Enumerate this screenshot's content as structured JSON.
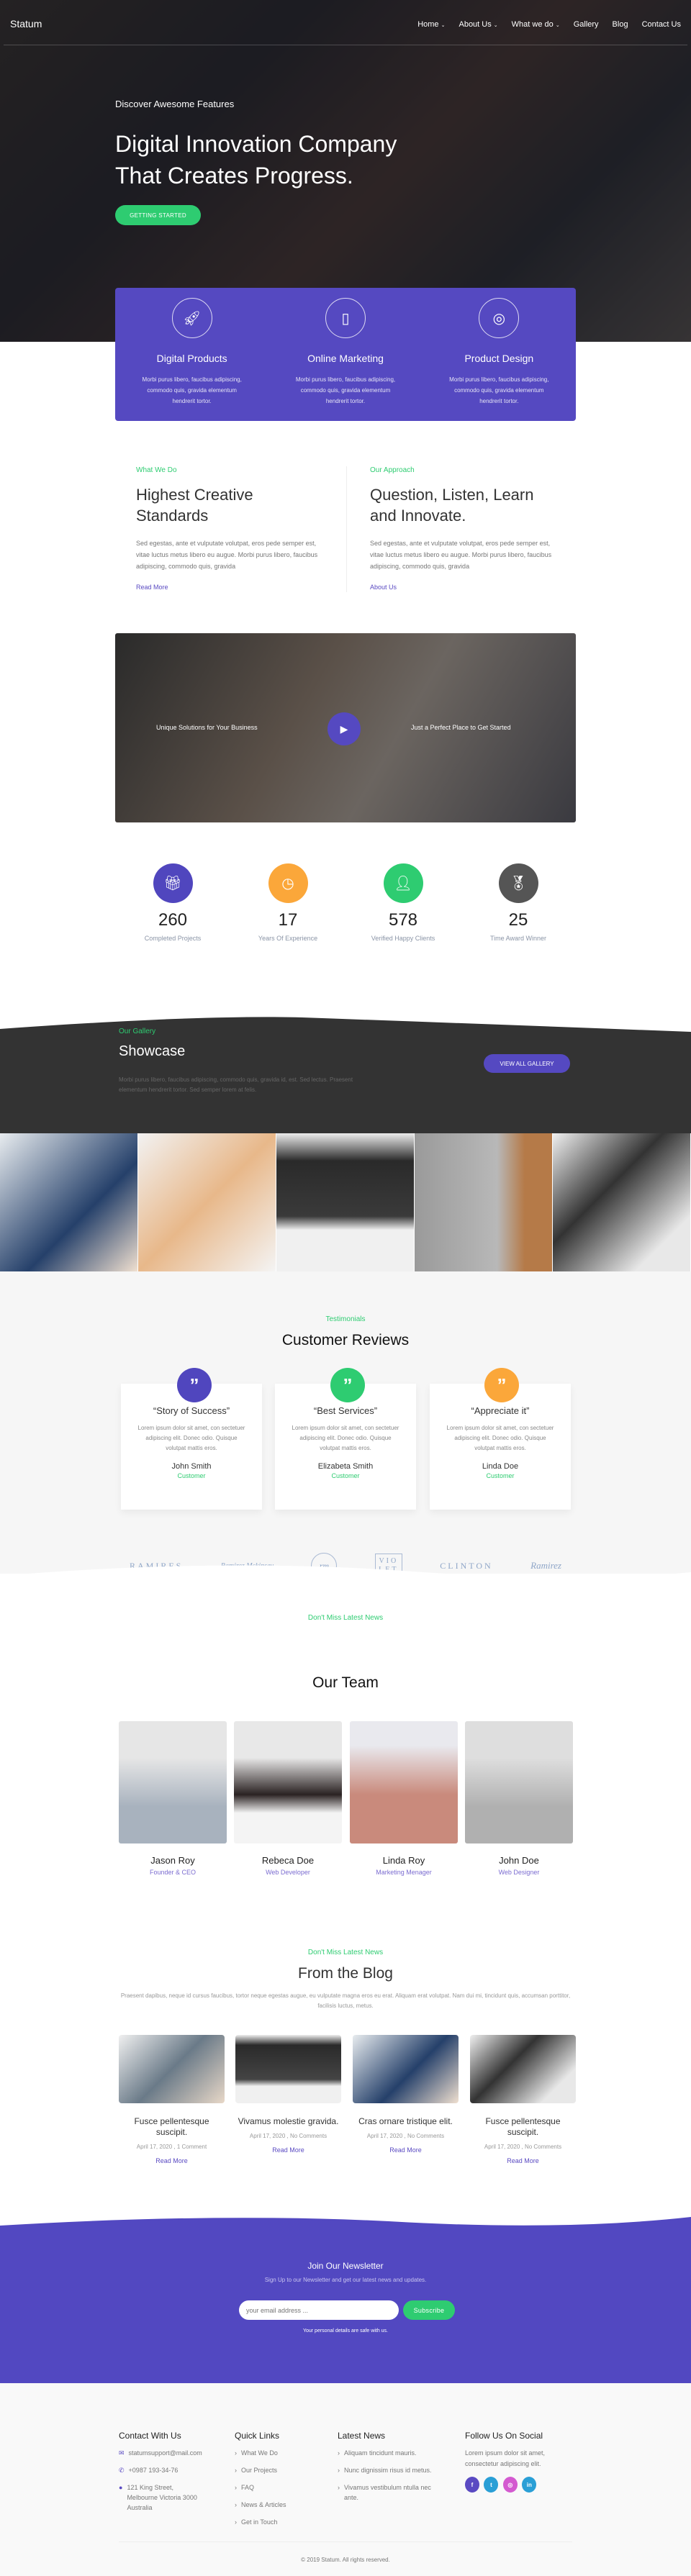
{
  "nav": {
    "brand": "Statum",
    "items": [
      {
        "label": "Home",
        "dropdown": true
      },
      {
        "label": "About Us",
        "dropdown": true
      },
      {
        "label": "What we do",
        "dropdown": true
      },
      {
        "label": "Gallery"
      },
      {
        "label": "Blog"
      },
      {
        "label": "Contact Us"
      }
    ]
  },
  "hero": {
    "tagline": "Discover Awesome Features",
    "title_line1": "Digital Innovation Company",
    "title_line2": "That Creates Progress.",
    "cta": "GETTING STARTED"
  },
  "features": [
    {
      "icon": "rocket-icon",
      "title": "Digital Products",
      "text": "Morbi purus libero, faucibus adipiscing, commodo quis, gravida elementum hendrerit tortor."
    },
    {
      "icon": "mobile-icon",
      "title": "Online Marketing",
      "text": "Morbi purus libero, faucibus adipiscing, commodo quis, gravida elementum hendrerit tortor."
    },
    {
      "icon": "fingerprint-icon",
      "title": "Product Design",
      "text": "Morbi purus libero, faucibus adipiscing, commodo quis, gravida elementum hendrerit tortor."
    }
  ],
  "about": [
    {
      "label": "What We Do",
      "title": "Highest Creative Standards",
      "text": "Sed egestas, ante et vulputate volutpat, eros pede semper est, vitae luctus metus libero eu augue. Morbi purus libero, faucibus adipiscing, commodo quis, gravida",
      "link": "Read More"
    },
    {
      "label": "Our Approach",
      "title": "Question, Listen, Learn and Innovate.",
      "text": "Sed egestas, ante et vulputate volutpat, eros pede semper est, vitae luctus metus libero eu augue. Morbi purus libero, faucibus adipiscing, commodo quis, gravida",
      "link": "About Us"
    }
  ],
  "video": {
    "left_text": "Unique Solutions for Your Business",
    "right_text": "Just a Perfect Place to Get Started",
    "icon": "play-icon"
  },
  "stats": [
    {
      "value": "260",
      "label": "Completed Projects",
      "color": "#5046be",
      "icon": "gift-icon"
    },
    {
      "value": "17",
      "label": "Years Of Experience",
      "color": "#fba73a",
      "icon": "clock-icon"
    },
    {
      "value": "578",
      "label": "Verified Happy Clients",
      "color": "#2ecc71",
      "icon": "user-icon"
    },
    {
      "value": "25",
      "label": "Time Award Winner",
      "color": "#555555",
      "icon": "award-icon"
    }
  ],
  "showcase": {
    "label": "Our Gallery",
    "title": "Showcase",
    "text": "Morbi purus libero, faucibus adipiscing, commodo quis, gravida id, est. Sed lectus. Praesent elementum hendrerit tortor. Sed semper lorem at felis.",
    "button": "VIEW ALL GALLERY"
  },
  "testimonials": {
    "label": "Testimonials",
    "title": "Customer Reviews",
    "items": [
      {
        "quote": "“Story of Success”",
        "text": "Lorem ipsum dolor sit amet, con sectetuer adipiscing elit. Donec odio. Quisque volutpat mattis eros.",
        "name": "John Smith",
        "role": "Customer",
        "color": "#5046be"
      },
      {
        "quote": "“Best Services”",
        "text": "Lorem ipsum dolor sit amet, con sectetuer adipiscing elit. Donec odio. Quisque volutpat mattis eros.",
        "name": "Elizabeta Smith",
        "role": "Customer",
        "color": "#2ecc71"
      },
      {
        "quote": "“Appreciate it”",
        "text": "Lorem ipsum dolor sit amet, con sectetuer adipiscing elit. Donec odio. Quisque volutpat mattis eros.",
        "name": "Linda Doe",
        "role": "Customer",
        "color": "#fba73a"
      }
    ]
  },
  "logos": [
    "RAMIRES",
    "Ramirez Mckinsey",
    "rm",
    "VIO LET",
    "CLINTON",
    "Ramirez"
  ],
  "team": {
    "label": "Don't Miss Latest News",
    "title": "Our Team",
    "members": [
      {
        "name": "Jason Roy",
        "role": "Founder & CEO"
      },
      {
        "name": "Rebeca Doe",
        "role": "Web Developer"
      },
      {
        "name": "Linda Roy",
        "role": "Marketing Menager"
      },
      {
        "name": "John Doe",
        "role": "Web Designer"
      }
    ]
  },
  "blog": {
    "label": "Don't Miss Latest News",
    "title": "From the Blog",
    "text": "Praesent dapibus, neque id cursus faucibus, tortor neque egestas augue, eu vulputate magna eros eu erat. Aliquam erat volutpat. Nam dui mi, tincidunt quis, accumsan porttitor, facilisis luctus, metus.",
    "posts": [
      {
        "title": "Fusce pellentesque suscipit.",
        "meta": "April 17, 2020 , 1 Comment",
        "link": "Read More"
      },
      {
        "title": "Vivamus molestie gravida.",
        "meta": "April 17, 2020 , No Comments",
        "link": "Read More"
      },
      {
        "title": "Cras ornare tristique elit.",
        "meta": "April 17, 2020 , No Comments",
        "link": "Read More"
      },
      {
        "title": "Fusce pellentesque suscipit.",
        "meta": "April 17, 2020 , No Comments",
        "link": "Read More"
      }
    ]
  },
  "newsletter": {
    "title": "Join Our Newsletter",
    "subtitle": "Sign Up to our Newsletter and get our latest news and updates.",
    "placeholder": "your email address ...",
    "button": "Subscribe",
    "note": "Your personal details are safe with us."
  },
  "footer": {
    "contact": {
      "title": "Contact With Us",
      "email": "statumsupport@mail.com",
      "phone": "+0987 193-34-76",
      "address": "121 King Street, Melbourne Victoria 3000 Australia"
    },
    "quick": {
      "title": "Quick Links",
      "items": [
        "What We Do",
        "Our Projects",
        "FAQ",
        "News & Articles",
        "Get in Touch"
      ]
    },
    "news": {
      "title": "Latest News",
      "items": [
        "Aliquam tincidunt mauris.",
        "Nunc dignissim risus id metus.",
        "Vivamus vestibulum ntulla nec ante."
      ]
    },
    "social": {
      "title": "Follow Us On Social",
      "text": "Lorem ipsum dolor sit amet, consectetur adipiscing elit.",
      "icons": [
        {
          "name": "facebook-icon",
          "glyph": "f",
          "color": "#5a4ac2"
        },
        {
          "name": "twitter-icon",
          "glyph": "t",
          "color": "#2a9fd6"
        },
        {
          "name": "instagram-icon",
          "glyph": "◎",
          "color": "#d45ad0"
        },
        {
          "name": "linkedin-icon",
          "glyph": "in",
          "color": "#2a9fd6"
        }
      ]
    },
    "copyright": "© 2019 Statum. All rights reserved."
  },
  "colors": {
    "accent": "#5549c1",
    "green": "#2ecc71",
    "dark": "#333333"
  }
}
